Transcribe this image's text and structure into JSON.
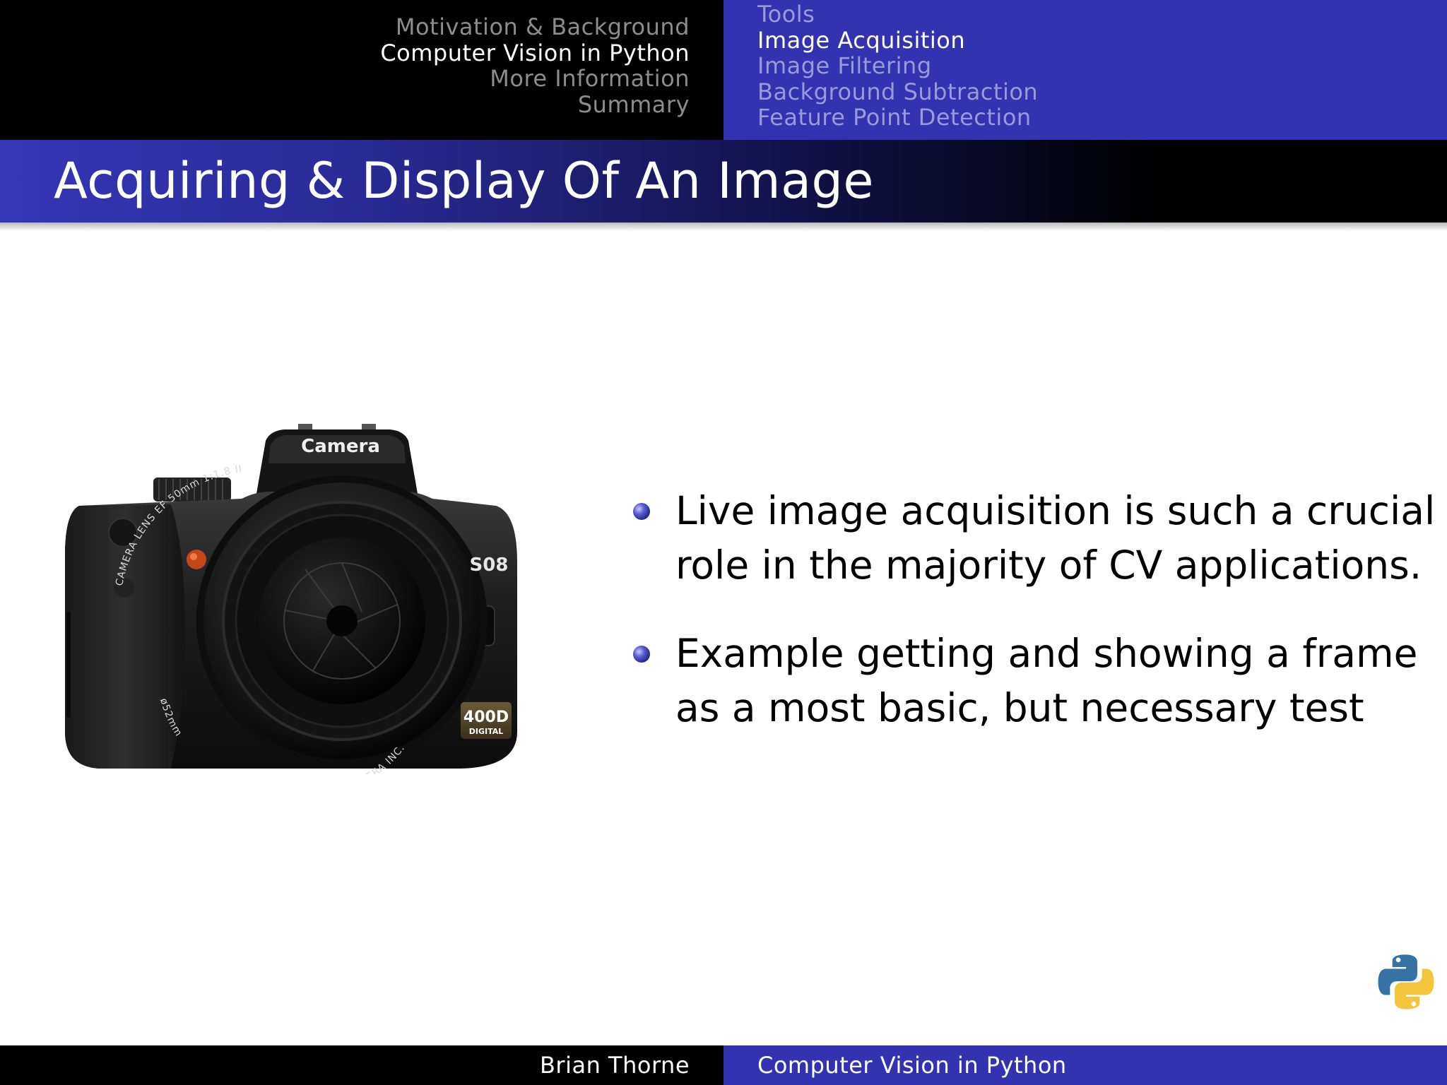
{
  "header": {
    "sections": [
      {
        "label": "Motivation & Background",
        "active": false
      },
      {
        "label": "Computer Vision in Python",
        "active": true
      },
      {
        "label": "More Information",
        "active": false
      },
      {
        "label": "Summary",
        "active": false
      }
    ],
    "subsections": [
      {
        "label": "Tools",
        "active": false
      },
      {
        "label": "Image Acquisition",
        "active": true
      },
      {
        "label": "Image Filtering",
        "active": false
      },
      {
        "label": "Background Subtraction",
        "active": false
      },
      {
        "label": "Feature Point Detection",
        "active": false
      }
    ]
  },
  "frame_title": "Acquiring & Display Of An Image",
  "camera_image": {
    "icon": "dslr-camera-illustration",
    "prism_label": "Camera",
    "lens_ring_text": "CAMERA LENS EF 50mm 1:1.8 II",
    "lens_size": "ø52mm",
    "lens_maker": "CAMERA INC.",
    "model_number": "S08",
    "badge_model": "400D",
    "badge_sub": "DIGITAL"
  },
  "bullets": [
    {
      "lines": [
        "Live image acquisition is such a crucial",
        "role in the majority of CV applications."
      ]
    },
    {
      "lines": [
        "Example getting and showing a frame",
        "as a most basic, but necessary test"
      ]
    }
  ],
  "logo": {
    "icon": "python-logo-icon"
  },
  "footer": {
    "author": "Brian Thorne",
    "title": "Computer Vision in Python"
  },
  "colors": {
    "theme_blue": "#3333b2",
    "header_black": "#000000",
    "inactive_section": "#8c8c8c",
    "inactive_subsection": "#9a9ad8",
    "text": "#000000",
    "background": "#ffffff"
  }
}
